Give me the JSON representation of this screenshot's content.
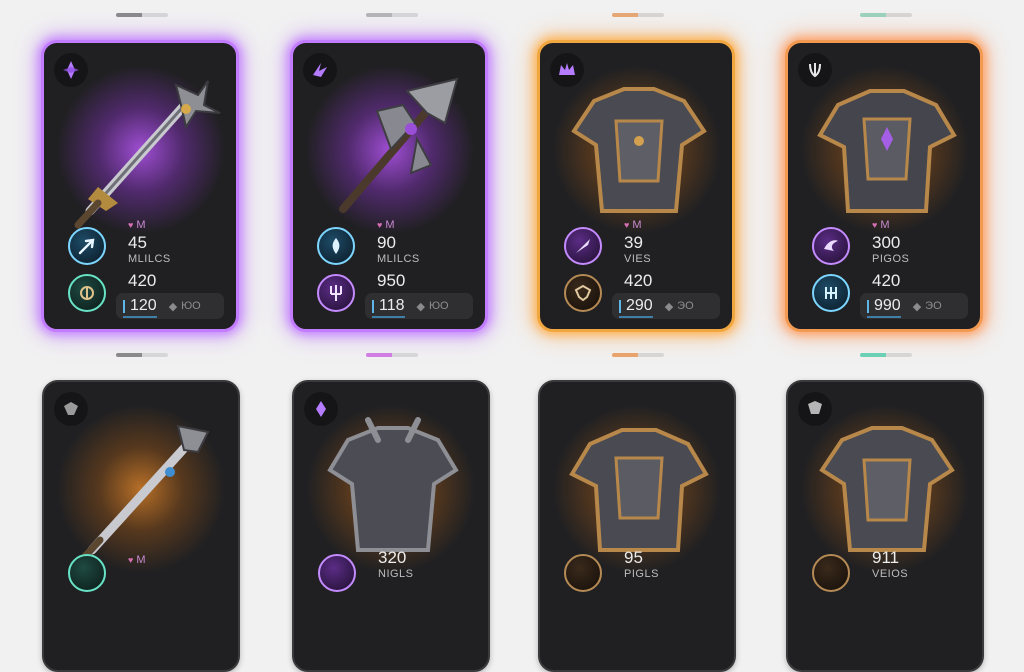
{
  "cards": [
    {
      "rarity": "purple",
      "stat_head": "M",
      "stat1": "45",
      "stat_label": "MLILCS",
      "stat3": "420",
      "bar_value": "120",
      "bar_sub": "ЮО"
    },
    {
      "rarity": "purple",
      "stat_head": "M",
      "stat1": "90",
      "stat_label": "MLILCS",
      "stat3": "950",
      "bar_value": "118",
      "bar_sub": "ЮО"
    },
    {
      "rarity": "gold",
      "stat_head": "M",
      "stat1": "39",
      "stat_label": "VIES",
      "stat3": "420",
      "bar_value": "290",
      "bar_sub": "ЭО"
    },
    {
      "rarity": "orange",
      "stat_head": "M",
      "stat1": "300",
      "stat_label": "PIGOS",
      "stat3": "420",
      "bar_value": "990",
      "bar_sub": "ЭО"
    },
    {
      "rarity": "plain",
      "stat_head": "M",
      "stat1": "",
      "stat_label": "",
      "stat3": "",
      "bar_value": "",
      "bar_sub": ""
    },
    {
      "rarity": "plain",
      "stat_head": "",
      "stat1": "320",
      "stat_label": "NIGLS",
      "stat3": "",
      "bar_value": "",
      "bar_sub": ""
    },
    {
      "rarity": "plain",
      "stat_head": "",
      "stat1": "95",
      "stat_label": "PIGLS",
      "stat3": "",
      "bar_value": "",
      "bar_sub": ""
    },
    {
      "rarity": "plain",
      "stat_head": "",
      "stat1": "911",
      "stat_label": "VEIOS",
      "stat3": "",
      "bar_value": "",
      "bar_sub": ""
    }
  ],
  "colors": {
    "purple": "#c27cff",
    "gold": "#f0a740",
    "orange": "#f39a52",
    "teal": "#4fc1a0"
  }
}
